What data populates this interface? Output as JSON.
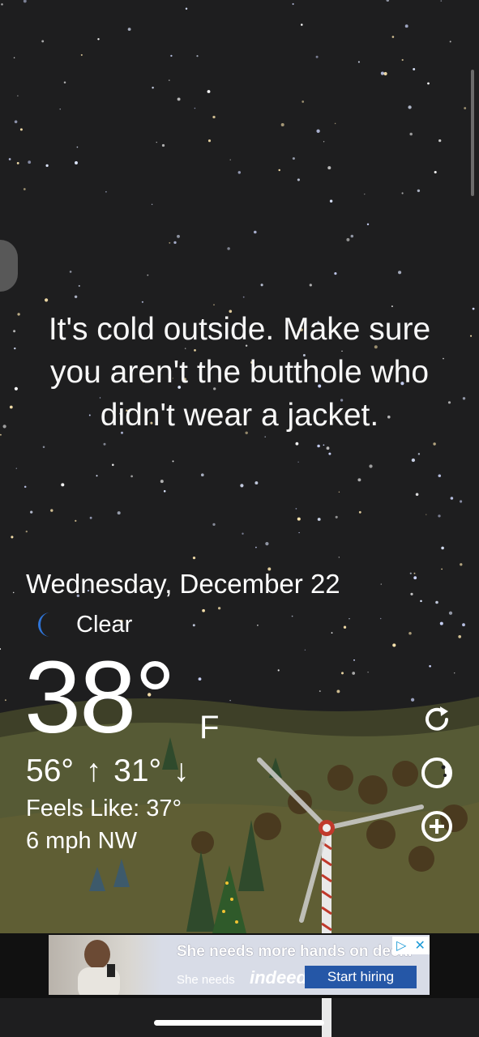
{
  "quote": {
    "line1": "It's cold outside. Make sure",
    "line2": "you aren't the butthole who",
    "line3": "didn't wear a jacket."
  },
  "weather": {
    "date": "Wednesday, December 22",
    "condition": "Clear",
    "condition_icon": "moon-icon",
    "temperature": "38°",
    "unit": "F",
    "high": "56°",
    "high_arrow": "↑",
    "low": "31°",
    "low_arrow": "↓",
    "feels_like": "Feels Like: 37°",
    "wind": "6 mph NW"
  },
  "actions": {
    "refresh_icon": "refresh-icon",
    "theme_icon": "moon-phase-icon",
    "add_icon": "add-circle-icon"
  },
  "ad": {
    "headline": "She needs more hands on deck.",
    "sub": "She needs",
    "brand": "indeed",
    "cta": "Start hiring",
    "choice_icon": "ad-choices-icon",
    "close_icon": "close-icon"
  },
  "colors": {
    "sky": "#1e1e1f",
    "hill": "#565a35",
    "moon": "#2f74d6",
    "cta": "#2557a7"
  }
}
